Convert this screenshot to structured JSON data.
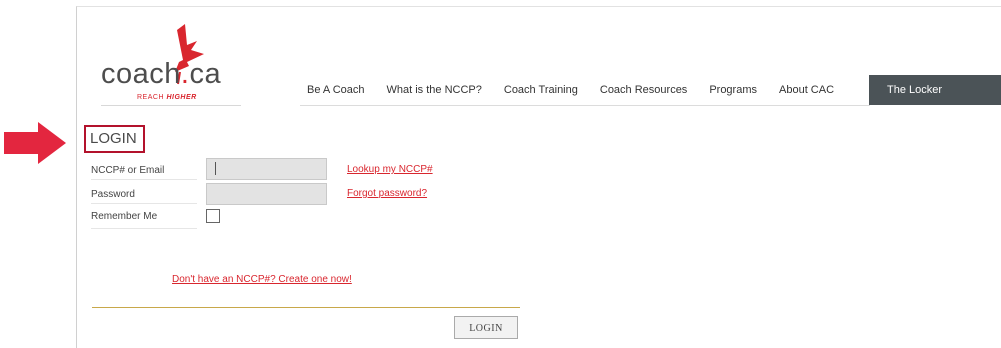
{
  "brand": {
    "logo_main": "coach",
    "logo_dot": ".",
    "logo_tld": "ca",
    "tagline_light": "REACH",
    "tagline_bold": "HIGHER",
    "accent_color": "#d9262e"
  },
  "nav": {
    "items": [
      {
        "label": "Be A Coach"
      },
      {
        "label": "What is the NCCP?"
      },
      {
        "label": "Coach Training"
      },
      {
        "label": "Coach Resources"
      },
      {
        "label": "Programs"
      },
      {
        "label": "About CAC"
      }
    ],
    "locker_label": "The Locker",
    "locker_color": "#4b5357"
  },
  "login": {
    "title": "LOGIN",
    "highlight_color": "#b3122c",
    "fields": {
      "nccp_label": "NCCP# or Email",
      "nccp_value": "",
      "password_label": "Password",
      "password_value": "",
      "remember_label": "Remember Me",
      "remember_checked": false
    },
    "links": {
      "lookup": "Lookup my NCCP#",
      "forgot": "Forgot password?",
      "create": "Don't have an NCCP#? Create one now!"
    },
    "submit_label": "LOGIN"
  },
  "annotation": {
    "arrow_icon": "right-arrow-icon",
    "arrow_color": "#e3263f"
  }
}
